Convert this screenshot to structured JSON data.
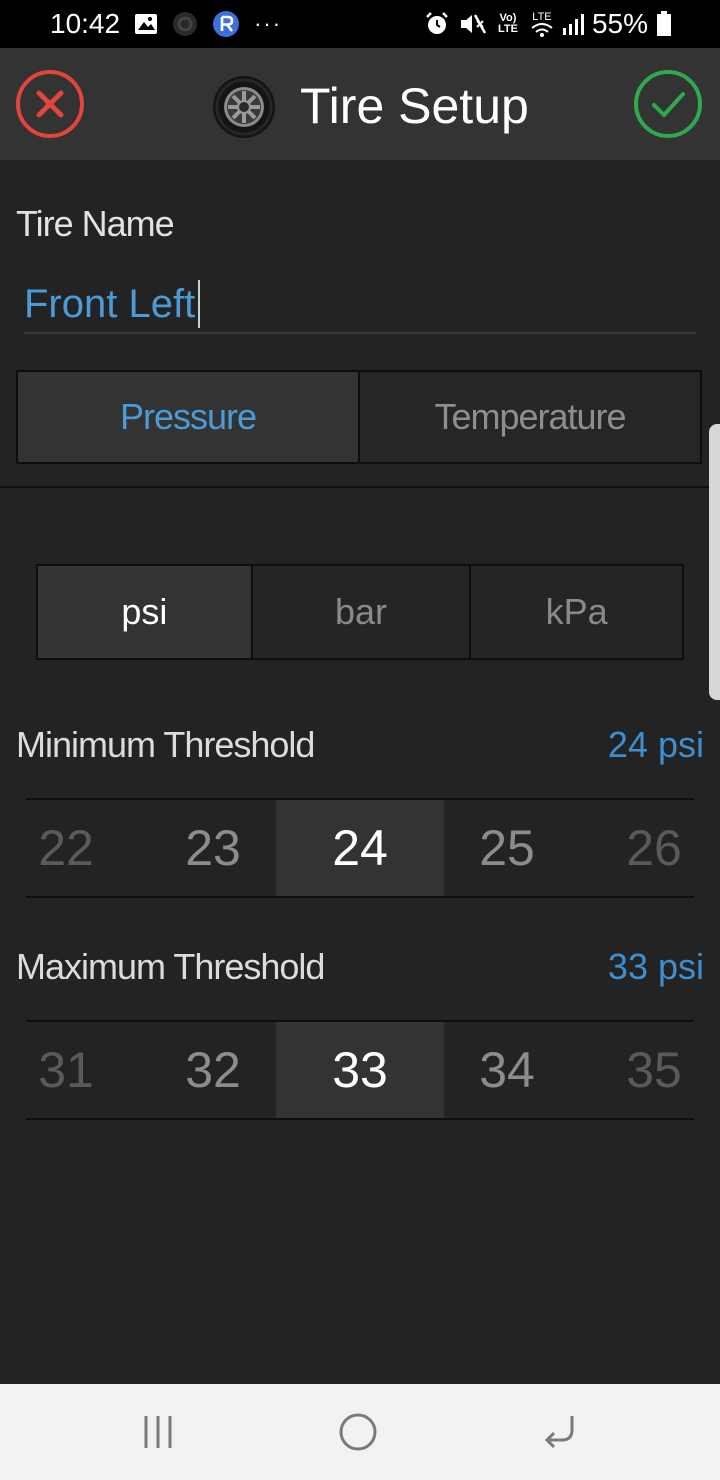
{
  "status_bar": {
    "time": "10:42",
    "battery_percent": "55%",
    "more_icon": "···",
    "volte_label": "Vo) LTE",
    "lte_label": "LTE"
  },
  "app_bar": {
    "title": "Tire Setup",
    "cancel_icon": "close-circle-icon",
    "confirm_icon": "check-circle-icon",
    "accent_cancel": "#e2453c",
    "accent_confirm": "#2fa84f"
  },
  "tire_name": {
    "label": "Tire Name",
    "value": "Front Left"
  },
  "tabs": [
    {
      "label": "Pressure",
      "selected": true
    },
    {
      "label": "Temperature",
      "selected": false
    }
  ],
  "units": [
    {
      "label": "psi",
      "selected": true
    },
    {
      "label": "bar",
      "selected": false
    },
    {
      "label": "kPa",
      "selected": false
    }
  ],
  "minimum": {
    "label": "Minimum Threshold",
    "value": "24 psi",
    "options": [
      "22",
      "23",
      "24",
      "25",
      "26"
    ],
    "selected": "24"
  },
  "maximum": {
    "label": "Maximum Threshold",
    "value": "33 psi",
    "options": [
      "31",
      "32",
      "33",
      "34",
      "35"
    ],
    "selected": "33"
  },
  "colors": {
    "accent_blue": "#4a9bd6",
    "background": "#232323"
  }
}
